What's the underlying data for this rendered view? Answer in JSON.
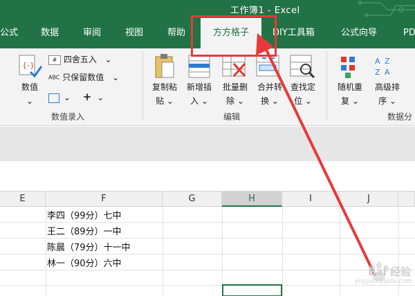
{
  "window": {
    "title": "工作簿1  -  Excel"
  },
  "tabs": [
    "公式",
    "数据",
    "审阅",
    "视图",
    "帮助",
    "方方格子",
    "DIY工具箱",
    "公式向导",
    "PD"
  ],
  "active_tab": "方方格子",
  "ribbon": {
    "numeric_value": {
      "line1": "数值",
      "line2": "⌄"
    },
    "round": "四舍五入",
    "keep_value": "只保留数值",
    "keep_value_prefix": "ABC",
    "group_numeric": "数值录入",
    "copy_paste": {
      "line1": "复制粘",
      "line2": "贴 ⌄"
    },
    "insert": {
      "line1": "新增插",
      "line2": "入 ⌄"
    },
    "delete": {
      "line1": "批量删",
      "line2": "除 ⌄"
    },
    "merge": {
      "line1": "合并转",
      "line2": "换 ⌄"
    },
    "locate": {
      "line1": "查找定",
      "line2": "位 ⌄"
    },
    "group_edit": "编辑",
    "random": {
      "line1": "随机重",
      "line2": "复 ⌄"
    },
    "sort": {
      "line1": "高级排",
      "line2": "序 ⌄"
    },
    "group_data": "数据分"
  },
  "columns": [
    "E",
    "F",
    "G",
    "H",
    "I",
    "J"
  ],
  "selected_column": "H",
  "cells": [
    "李四（99分）七中",
    "王二（89分）一中",
    "陈晨（79分）十一中",
    "林一（90分）六中"
  ],
  "watermark": {
    "main": "Bai 经验",
    "sub": "jingyan.baidu.com"
  },
  "colors": {
    "excel_green": "#217346",
    "annotation_red": "#e8393c"
  }
}
